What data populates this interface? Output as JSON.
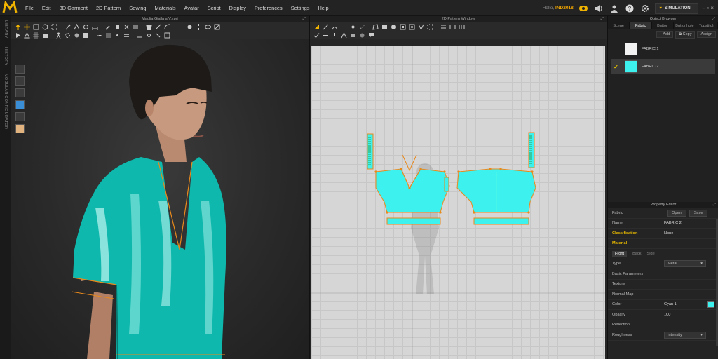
{
  "app": {
    "menu": [
      "File",
      "Edit",
      "3D Garment",
      "2D Pattern",
      "Sewing",
      "Materials",
      "Avatar",
      "Script",
      "Display",
      "Preferences",
      "Settings",
      "Help"
    ],
    "hello_label": "Hello,",
    "user": "IND2018",
    "simulation_label": "SIMULATION",
    "win_controls": "– ▫ ×"
  },
  "side_tabs": [
    "LIBRARY",
    "HISTORY",
    "MODULAR CONFIGURATOR"
  ],
  "window3d": {
    "title": "Maglia Gialla a V.zprj"
  },
  "window2d": {
    "title": "2D Pattern Window"
  },
  "object_browser": {
    "title": "Object Browser",
    "tabs": [
      "Scene",
      "Fabric",
      "Button",
      "Buttonhole",
      "Topstitch"
    ],
    "active_tab": "Fabric",
    "add_label": "+ Add",
    "copy_label": "⧉ Copy",
    "assign_label": "Assign",
    "fabrics": [
      {
        "name": "FABRIC 1",
        "color": "#f2f2f2",
        "selected": false
      },
      {
        "name": "FABRIC 2",
        "color": "#3df2ee",
        "selected": true
      }
    ]
  },
  "property_editor": {
    "title": "Property Editor",
    "fabric_label": "Fabric",
    "open_label": "Open",
    "save_label": "Save",
    "name_label": "Name",
    "name_value": "FABRIC 2",
    "classification_label": "Classification",
    "classification_value": "None",
    "material_label": "Material",
    "side_tabs": [
      "Front",
      "Back",
      "Side"
    ],
    "type_label": "Type",
    "type_value": "Metal",
    "basic_params_label": "Basic Parameters",
    "texture_label": "Texture",
    "normal_map_label": "Normal Map",
    "color_label": "Color",
    "color_value": "Cyan 1",
    "color_hex": "#3df2ee",
    "opacity_label": "Opacity",
    "opacity_value": "100",
    "reflection_label": "Reflection",
    "roughness_label": "Roughness",
    "roughness_value": "Intensity"
  },
  "colors": {
    "garment": "#0fb8ac",
    "pattern": "#3df2ee",
    "accent": "#e6b800",
    "seam": "#e8891c"
  }
}
